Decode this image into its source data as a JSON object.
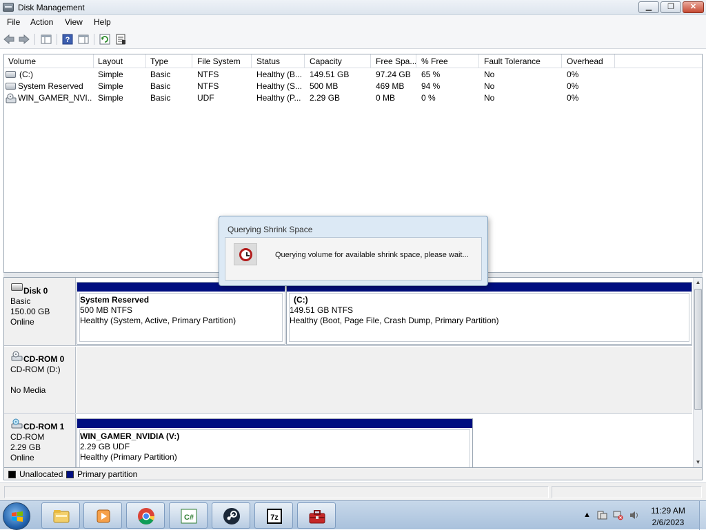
{
  "window": {
    "title": "Disk Management",
    "minimize": "▁",
    "maximize": "❐",
    "close": "✕"
  },
  "menu": [
    "File",
    "Action",
    "View",
    "Help"
  ],
  "columns": [
    "Volume",
    "Layout",
    "Type",
    "File System",
    "Status",
    "Capacity",
    "Free Spa...",
    "% Free",
    "Fault Tolerance",
    "Overhead"
  ],
  "volumes": [
    {
      "icon": "hard-disk-icon",
      "name": "(C:)",
      "layout": "Simple",
      "type": "Basic",
      "fs": "NTFS",
      "status": "Healthy (B...",
      "capacity": "149.51 GB",
      "free": "97.24 GB",
      "pct": "65 %",
      "fault": "No",
      "overhead": "0%"
    },
    {
      "icon": "hard-disk-icon",
      "name": "System Reserved",
      "layout": "Simple",
      "type": "Basic",
      "fs": "NTFS",
      "status": "Healthy (S...",
      "capacity": "500 MB",
      "free": "469 MB",
      "pct": "94 %",
      "fault": "No",
      "overhead": "0%"
    },
    {
      "icon": "cd-drive-icon",
      "name": "WIN_GAMER_NVI...",
      "layout": "Simple",
      "type": "Basic",
      "fs": "UDF",
      "status": "Healthy (P...",
      "capacity": "2.29 GB",
      "free": "0 MB",
      "pct": "0 %",
      "fault": "No",
      "overhead": "0%"
    }
  ],
  "disks": [
    {
      "name": "Disk 0",
      "type": "Basic",
      "size": "150.00 GB",
      "state": "Online",
      "partitions": [
        {
          "title": "System Reserved",
          "size": "500 MB NTFS",
          "status": "Healthy (System, Active, Primary Partition)"
        },
        {
          "title": "(C:)",
          "size": "149.51 GB NTFS",
          "status": "Healthy (Boot, Page File, Crash Dump, Primary Partition)"
        }
      ]
    },
    {
      "name": "CD-ROM 0",
      "type": "CD-ROM (D:)",
      "state": "No Media"
    },
    {
      "name": "CD-ROM 1",
      "type": "CD-ROM",
      "size": "2.29 GB",
      "state": "Online",
      "partitions": [
        {
          "title": "WIN_GAMER_NVIDIA  (V:)",
          "size": "2.29 GB UDF",
          "status": "Healthy (Primary Partition)"
        }
      ]
    }
  ],
  "legend": {
    "unallocated": "Unallocated",
    "primary": "Primary partition",
    "unallocated_color": "#000000",
    "primary_color": "#000e80"
  },
  "dialog": {
    "title": "Querying Shrink Space",
    "message": "Querying volume for available shrink space, please wait..."
  },
  "taskbar": {
    "apps": [
      "windows-explorer-icon",
      "media-player-icon",
      "chrome-icon",
      "csharp-editor-icon",
      "steam-icon",
      "7zip-icon",
      "toolbox-icon"
    ],
    "time": "11:29 AM",
    "date": "2/6/2023"
  }
}
